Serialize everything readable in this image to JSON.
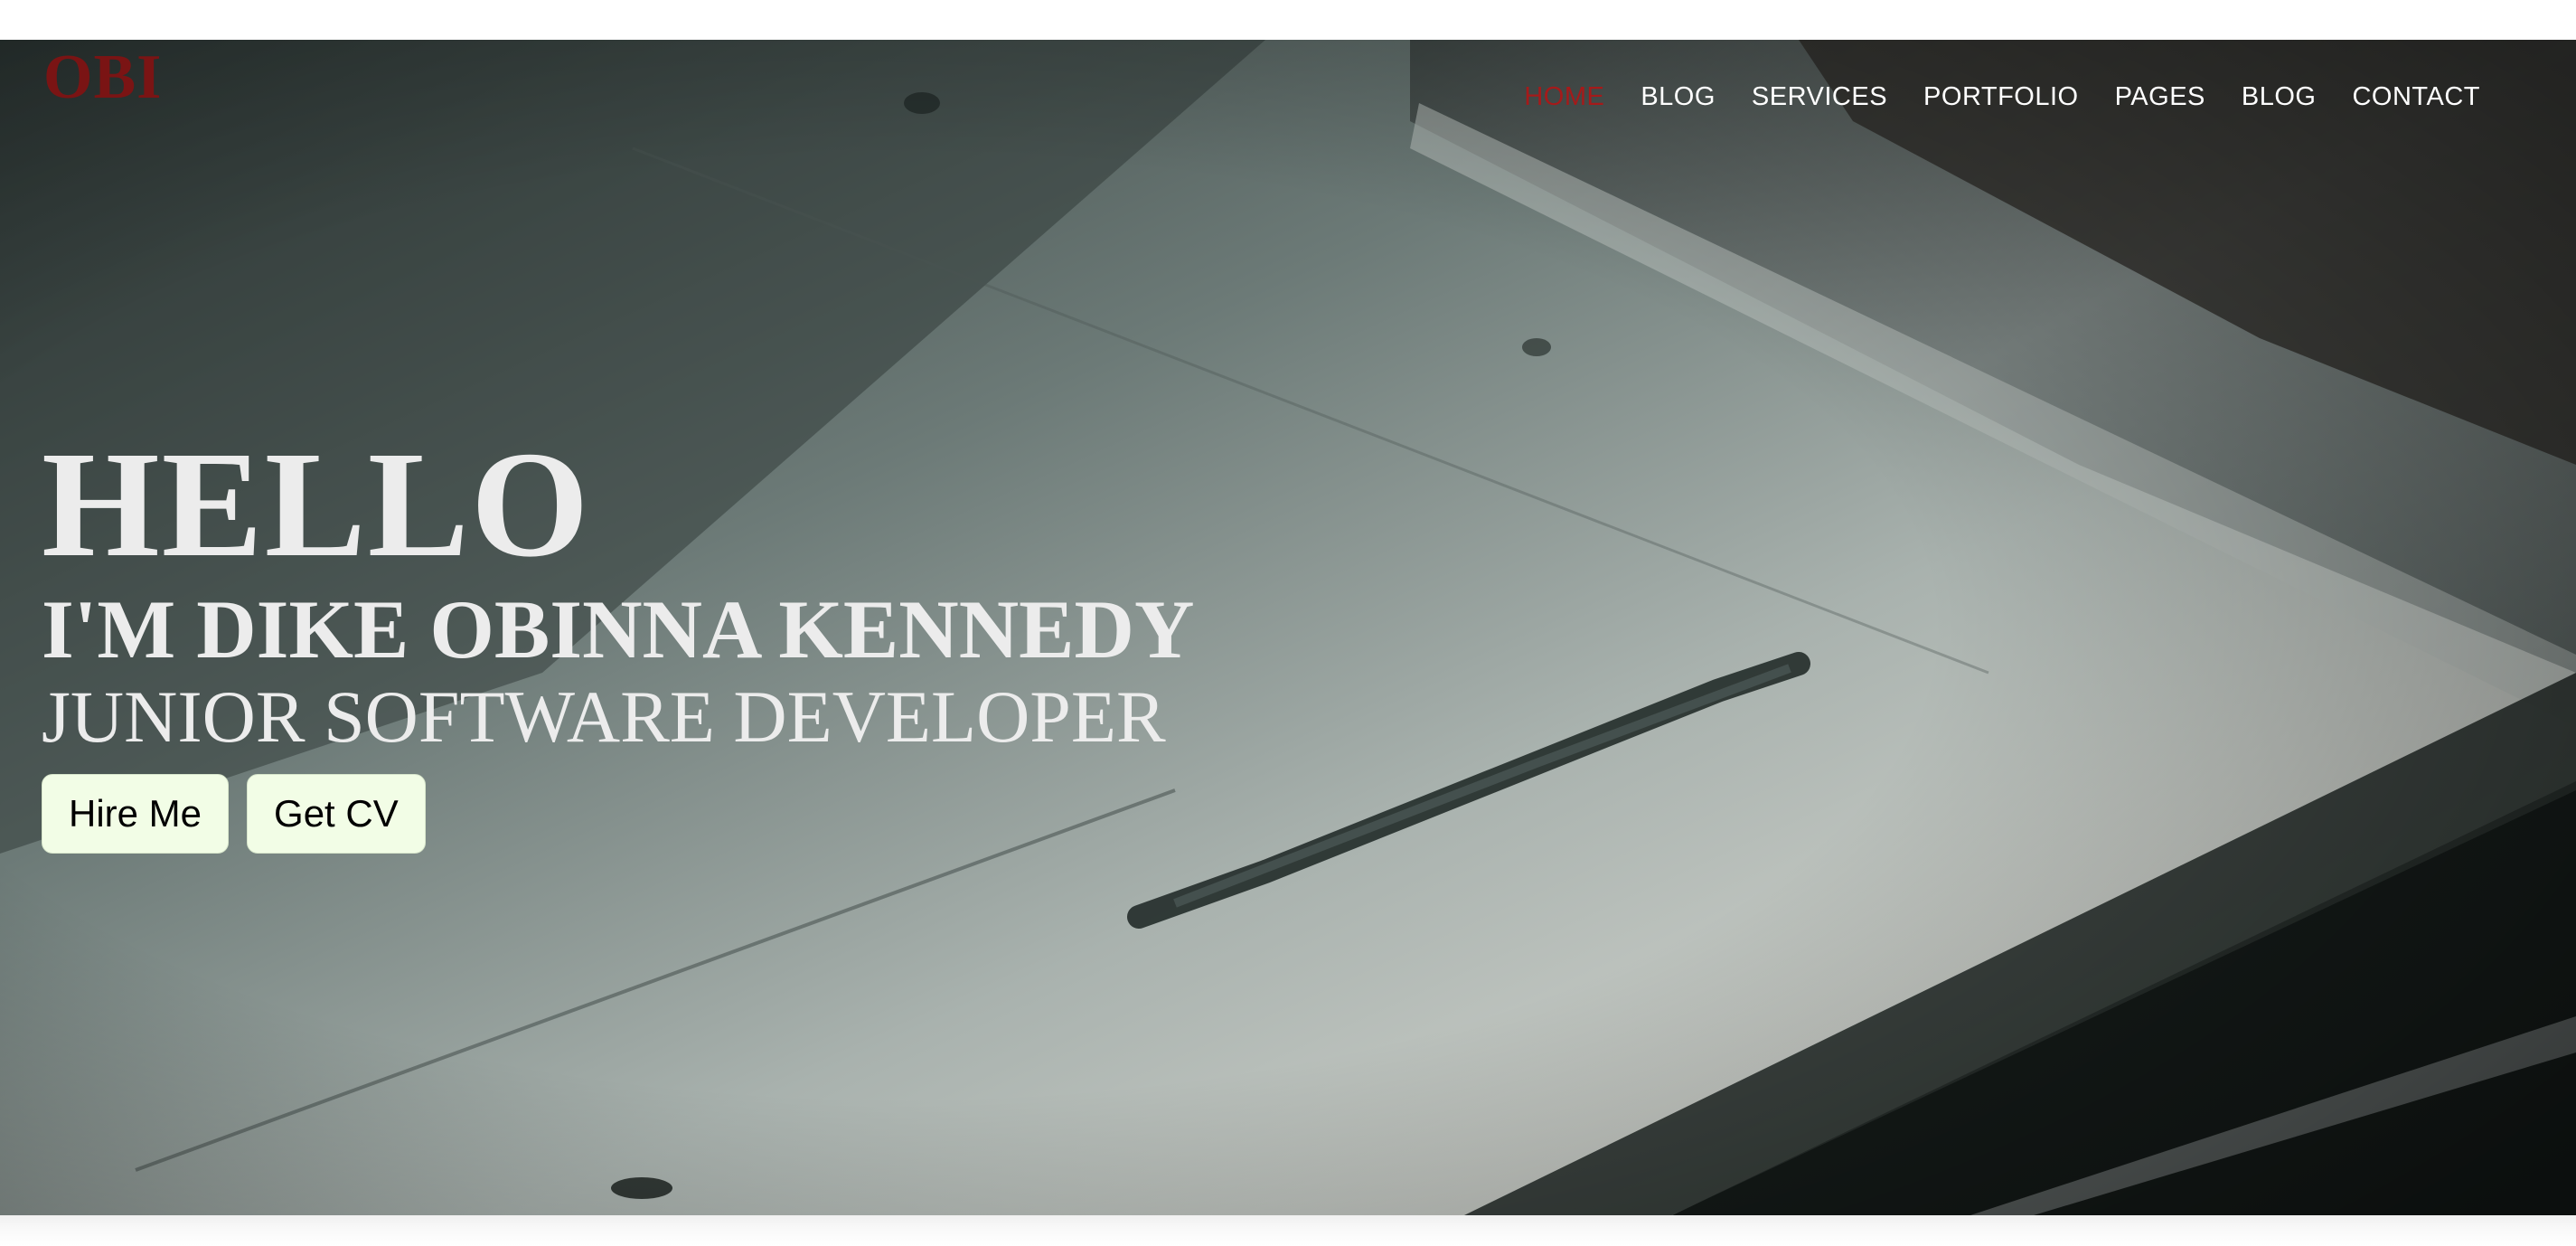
{
  "header": {
    "logo": "OBI",
    "nav": [
      {
        "label": "HOME",
        "active": true
      },
      {
        "label": "BLOG",
        "active": false
      },
      {
        "label": "SERVICES",
        "active": false
      },
      {
        "label": "PORTFOLIO",
        "active": false
      },
      {
        "label": "PAGES",
        "active": false
      },
      {
        "label": "BLOG",
        "active": false
      },
      {
        "label": "CONTACT",
        "active": false
      }
    ]
  },
  "hero": {
    "greeting": "HELLO",
    "name_line": "I'M DIKE OBINNA KENNEDY",
    "role_line": "JUNIOR SOFTWARE DEVELOPER",
    "buttons": {
      "hire_label": "Hire Me",
      "cv_label": "Get CV"
    },
    "background_description_colors": {
      "concrete": "#9aa6a4",
      "dark": "#1e2422",
      "light": "#d9dcd8"
    }
  },
  "colors": {
    "accent": "#a51a1a",
    "logo": "#7a1414",
    "button_bg": "#f2fde6",
    "hero_text": "#ececec"
  }
}
